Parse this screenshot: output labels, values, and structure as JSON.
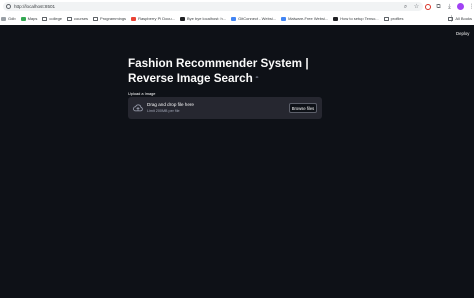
{
  "browser": {
    "url": "http://localhost:8501",
    "bookmarks": [
      {
        "label": "Gdb",
        "kind": "plain"
      },
      {
        "label": "Maps",
        "kind": "green"
      },
      {
        "label": "college",
        "kind": "folder"
      },
      {
        "label": "courses",
        "kind": "folder"
      },
      {
        "label": "Programmings",
        "kind": "folder"
      },
      {
        "label": "Raspberry Pi Docu...",
        "kind": "red"
      },
      {
        "label": "Bye bye localhost: h...",
        "kind": "dark"
      },
      {
        "label": "GitConnect - Websi...",
        "kind": "blue"
      },
      {
        "label": "Malware-Free Websi...",
        "kind": "blue"
      },
      {
        "label": "How to setup Tenso...",
        "kind": "dark"
      },
      {
        "label": "profiles",
        "kind": "folder"
      }
    ],
    "all_bookmarks_label": "All Books",
    "colors": {
      "avatar": "#a142f4",
      "extension": "#d93025"
    }
  },
  "app": {
    "deploy_label": "Deploy",
    "title_line1": "Fashion Recommender System |",
    "title_line2": "Reverse Image Search",
    "upload_label": "Upload a Image",
    "dropzone": {
      "title": "Drag and drop file here",
      "limit": "Limit 200MB per file",
      "browse_label": "Browse files"
    },
    "colors": {
      "background": "#0e1117",
      "dropzone": "#262730",
      "text": "#fafafa"
    }
  }
}
